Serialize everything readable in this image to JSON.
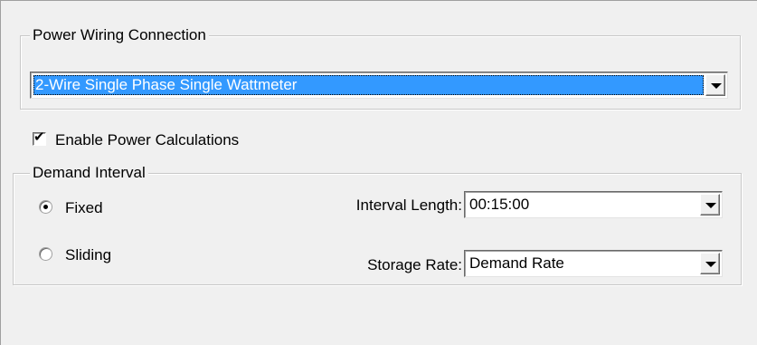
{
  "power_wiring": {
    "legend": "Power Wiring Connection",
    "selected": "2-Wire Single Phase Single Wattmeter"
  },
  "enable_power": {
    "label": "Enable Power Calculations",
    "checked": true
  },
  "demand_interval": {
    "legend": "Demand Interval",
    "options": [
      {
        "label": "Fixed",
        "selected": true
      },
      {
        "label": "Sliding",
        "selected": false
      }
    ],
    "interval_length_label": "Interval Length:",
    "interval_length_value": "00:15:00",
    "storage_rate_label": "Storage Rate:",
    "storage_rate_value": "Demand Rate"
  },
  "icons": {
    "dropdown": "chevron-down-icon",
    "check": "check-icon",
    "radio": "radio-dot-icon"
  }
}
